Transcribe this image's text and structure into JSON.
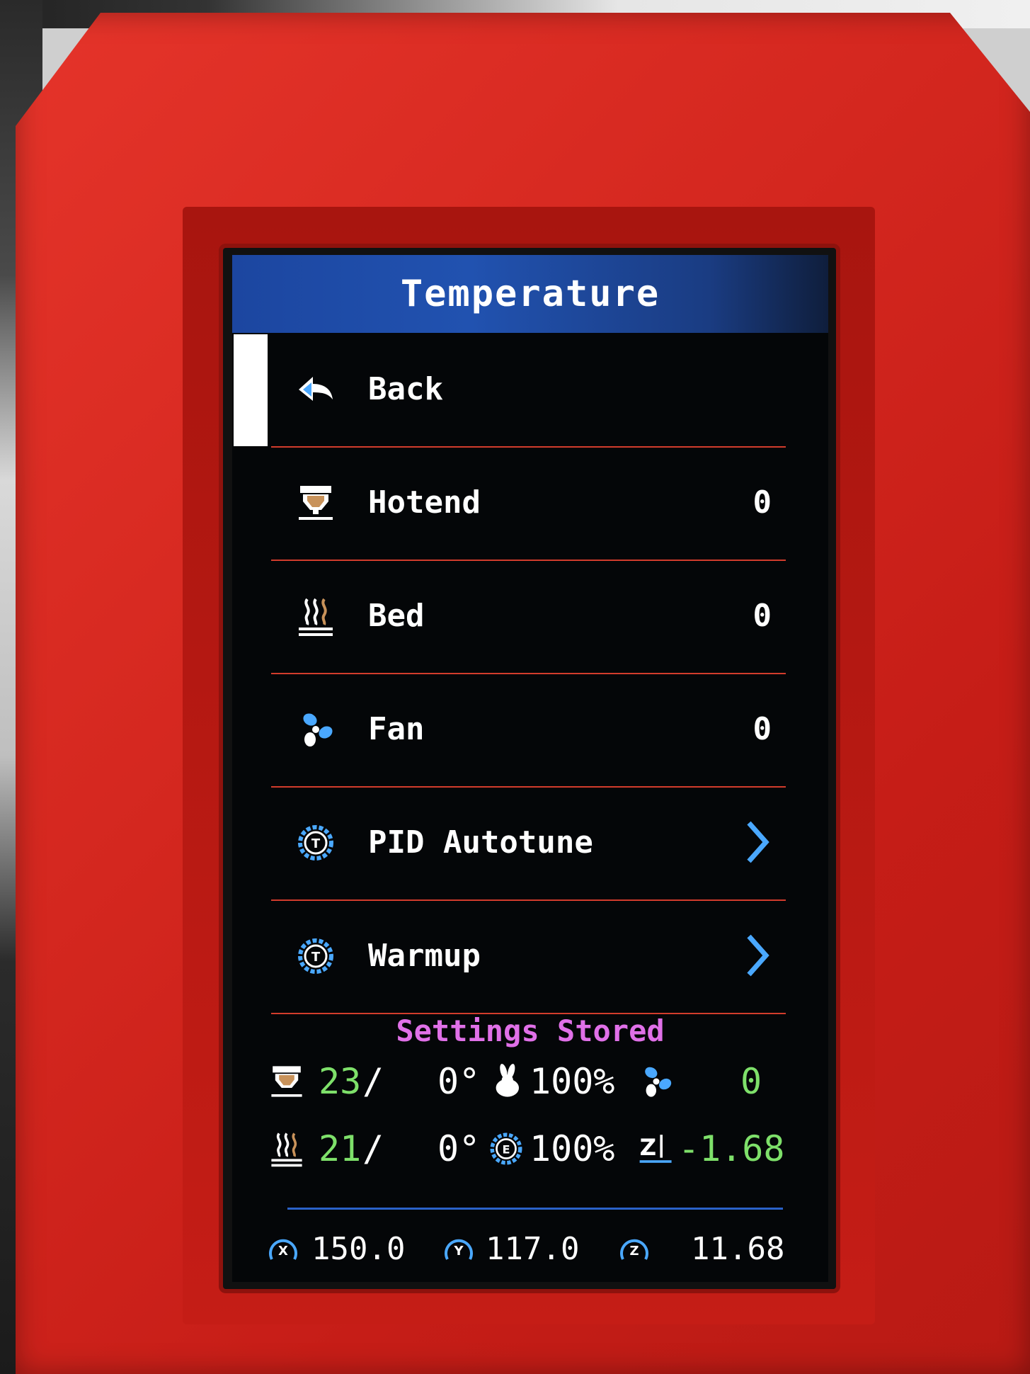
{
  "screen": {
    "title": "Temperature"
  },
  "menu": {
    "items": [
      {
        "label": "Back",
        "icon": "back-arrow-icon"
      },
      {
        "label": "Hotend",
        "icon": "hotend-icon",
        "value": "0"
      },
      {
        "label": "Bed",
        "icon": "bed-heat-icon",
        "value": "0"
      },
      {
        "label": "Fan",
        "icon": "fan-icon",
        "value": "0"
      },
      {
        "label": "PID Autotune",
        "icon": "temperature-gear-icon",
        "submenu": true
      },
      {
        "label": "Warmup",
        "icon": "temperature-gear-icon",
        "submenu": true
      }
    ],
    "selected_index": 0
  },
  "status": {
    "message": "Settings Stored",
    "hotend_current": "23",
    "hotend_target": "0°",
    "feedrate": "100%",
    "fan": "0",
    "bed_current": "21",
    "bed_target": "0°",
    "flow": "100%",
    "z_offset": "-1.68"
  },
  "axes": {
    "x": "150.0",
    "y": "117.0",
    "z": "11.68"
  },
  "colors": {
    "title_bar": "#2152b0",
    "separator": "#d23c2c",
    "status_message": "#e070e8",
    "current_temp": "#7ee06a",
    "icon_blue": "#4aa8ff",
    "case_red": "#d4271f"
  }
}
